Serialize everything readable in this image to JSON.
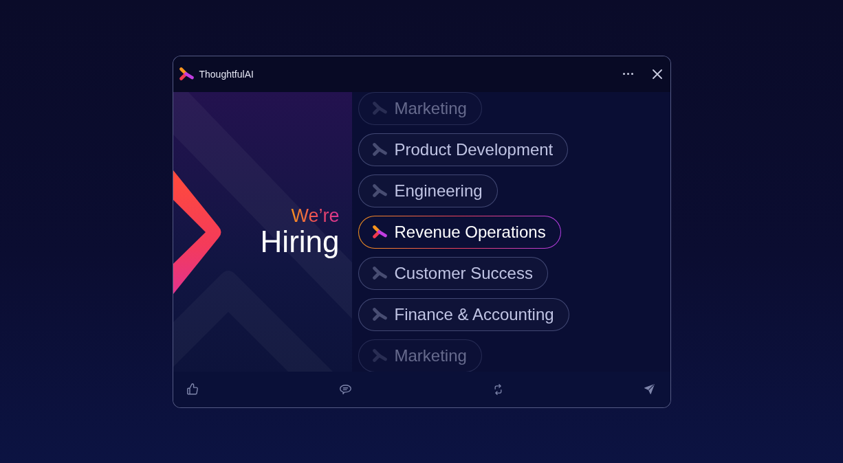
{
  "window": {
    "title": "ThoughtfulAI",
    "actions": [
      {
        "kind": "more"
      },
      {
        "kind": "close"
      }
    ]
  },
  "banner": {
    "eyebrow": "We’re",
    "headline": "Hiring"
  },
  "departments": [
    {
      "label": "Marketing",
      "selected": false,
      "faded": true
    },
    {
      "label": "Product Development",
      "selected": false,
      "faded": false
    },
    {
      "label": "Engineering",
      "selected": false,
      "faded": false
    },
    {
      "label": "Revenue Operations",
      "selected": true,
      "faded": false
    },
    {
      "label": "Customer Success",
      "selected": false,
      "faded": false
    },
    {
      "label": "Finance & Accounting",
      "selected": false,
      "faded": false
    },
    {
      "label": "Marketing",
      "selected": false,
      "faded": true
    }
  ],
  "toolbar": [
    {
      "kind": "like"
    },
    {
      "kind": "comment"
    },
    {
      "kind": "regenerate"
    },
    {
      "kind": "send"
    }
  ]
}
